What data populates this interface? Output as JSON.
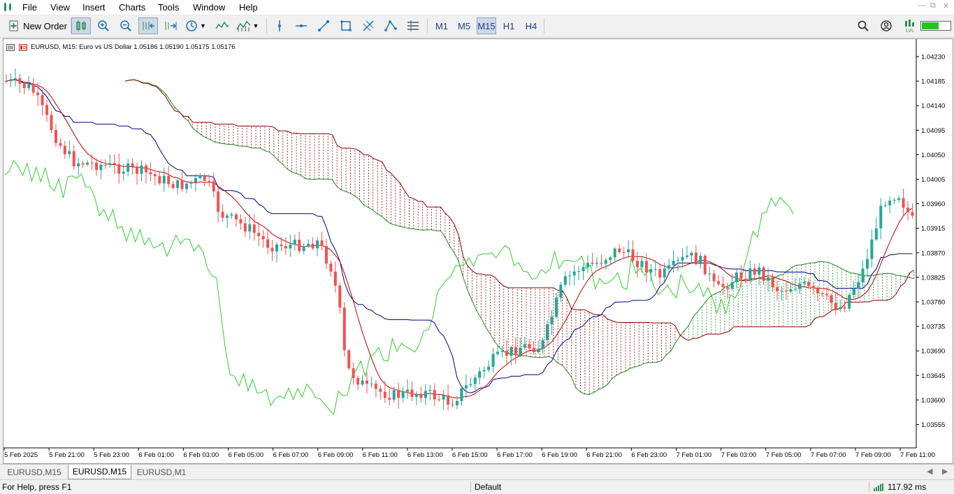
{
  "menu": [
    "File",
    "View",
    "Insert",
    "Charts",
    "Tools",
    "Window",
    "Help"
  ],
  "toolbar": {
    "new_order": "New Order",
    "timeframes": [
      "M1",
      "M5",
      "M15",
      "H1",
      "H4"
    ],
    "active_timeframe": "M15"
  },
  "chart": {
    "header": "EURUSD, M15:  Euro vs US Dollar  1.05186 1.05190 1.05175 1.05176",
    "price_labels": [
      "1.04230",
      "1.04185",
      "1.04140",
      "1.04095",
      "1.04050",
      "1.04005",
      "1.03960",
      "1.03915",
      "1.03870",
      "1.03825",
      "1.03780",
      "1.03735",
      "1.03690",
      "1.03645",
      "1.03600",
      "1.03555"
    ],
    "time_labels": [
      "5 Feb 2025",
      "5 Feb 21:00",
      "5 Feb 23:00",
      "6 Feb 01:00",
      "6 Feb 03:00",
      "6 Feb 05:00",
      "6 Feb 07:00",
      "6 Feb 09:00",
      "6 Feb 11:00",
      "6 Feb 13:00",
      "6 Feb 15:00",
      "6 Feb 17:00",
      "6 Feb 19:00",
      "6 Feb 21:00",
      "6 Feb 23:00",
      "7 Feb 01:00",
      "7 Feb 03:00",
      "7 Feb 05:00",
      "7 Feb 07:00",
      "7 Feb 09:00",
      "7 Feb 11:00"
    ],
    "colors": {
      "bull": "#26a69a",
      "bear": "#ef5350",
      "tenkan": "#c00000",
      "kijun": "#00008b",
      "chikou": "#32cd32",
      "span_a": "#228b22",
      "span_b": "#8b0000"
    }
  },
  "tabs": [
    "EURUSD,M15",
    "EURUSD,M15",
    "EURUSD,M1"
  ],
  "active_tab": 1,
  "status": {
    "help": "For Help, press F1",
    "profile": "Default",
    "ping": "117.92 ms"
  }
}
